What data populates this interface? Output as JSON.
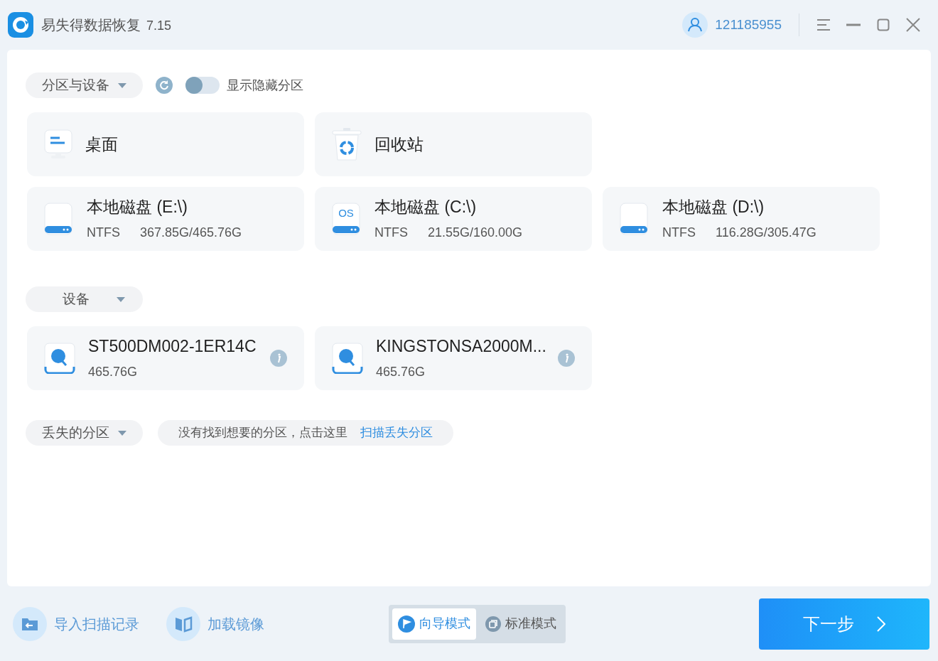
{
  "window": {
    "app_name": "易失得数据恢复",
    "version": "7.15",
    "user_id": "121185955"
  },
  "partitions_header": {
    "dropdown": "分区与设备",
    "toggle": {
      "label": "显示隐藏分区",
      "on": false
    }
  },
  "locations": [
    {
      "kind": "desktop",
      "title": "桌面"
    },
    {
      "kind": "recycle",
      "title": "回收站"
    }
  ],
  "partitions": [
    {
      "title": "本地磁盘 (E:\\)",
      "filesystem": "NTFS",
      "usage": "367.85G/465.76G"
    },
    {
      "title": "本地磁盘 (C:\\)",
      "filesystem": "NTFS",
      "usage": "21.55G/160.00G",
      "badge": "OS"
    },
    {
      "title": "本地磁盘 (D:\\)",
      "filesystem": "NTFS",
      "usage": "116.28G/305.47G"
    }
  ],
  "devices": {
    "dropdown": "设备",
    "items": [
      {
        "name": "ST500DM002-1ER14C",
        "size": "465.76G"
      },
      {
        "name": "KINGSTONSA2000M...",
        "size": "465.76G"
      }
    ]
  },
  "lost_partitions": {
    "dropdown": "丢失的分区",
    "hint": "没有找到想要的分区，点击这里",
    "link": "扫描丢失分区"
  },
  "footer": {
    "actions": [
      {
        "kind": "import",
        "label": "导入扫描记录"
      },
      {
        "kind": "image",
        "label": "加载镜像"
      }
    ],
    "modes": [
      {
        "kind": "wizard",
        "label": "向导模式",
        "selected": true
      },
      {
        "kind": "standard",
        "label": "标准模式",
        "selected": false
      }
    ],
    "next": "下一步"
  }
}
